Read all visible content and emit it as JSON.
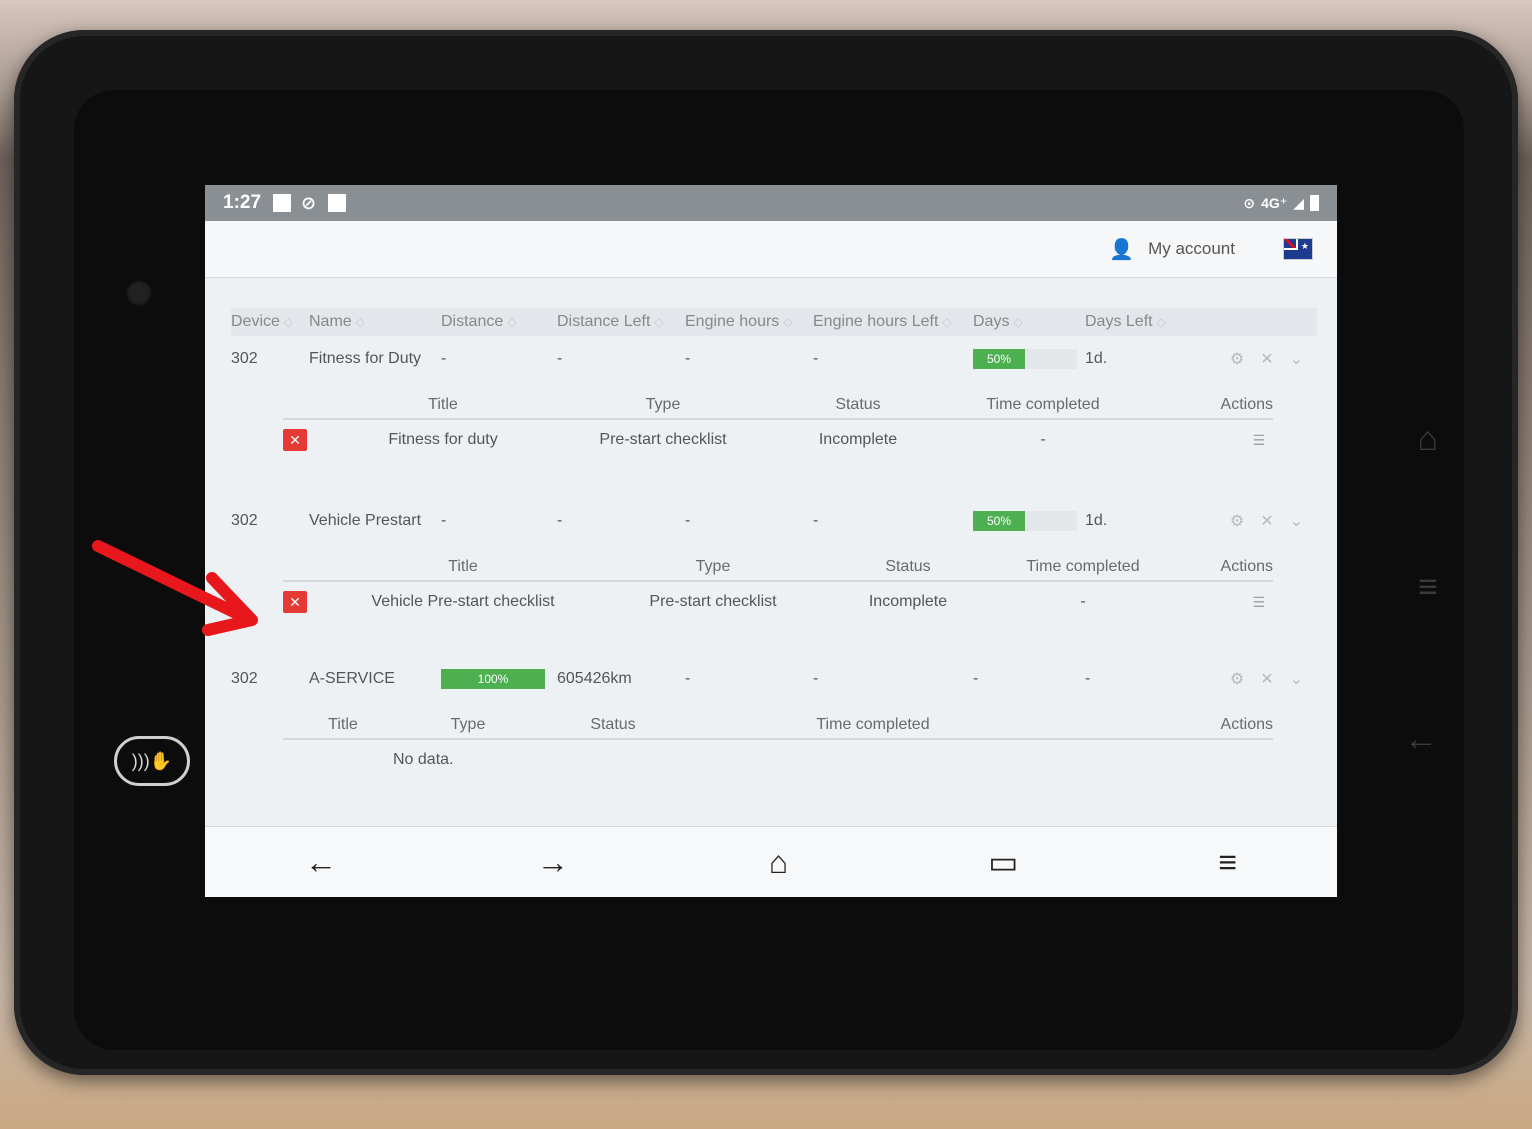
{
  "statusbar": {
    "time": "1:27",
    "network": "4G⁺"
  },
  "topbar": {
    "account_label": "My account"
  },
  "columns": [
    "Device",
    "Name",
    "Distance",
    "Distance Left",
    "Engine hours",
    "Engine hours Left",
    "Days",
    "Days Left"
  ],
  "rows": [
    {
      "device": "302",
      "name": "Fitness for Duty",
      "distance": "-",
      "distance_left": "-",
      "engine_hours": "-",
      "engine_hours_left": "-",
      "days_progress_label": "50%",
      "days_progress": 0.5,
      "days_left": "1d.",
      "sub_headers": [
        "Title",
        "Type",
        "Status",
        "Time completed",
        "Actions"
      ],
      "sub_rows": [
        {
          "title": "Fitness for duty",
          "type": "Pre-start checklist",
          "status": "Incomplete",
          "time_completed": "-"
        }
      ]
    },
    {
      "device": "302",
      "name": "Vehicle Prestart",
      "distance": "-",
      "distance_left": "-",
      "engine_hours": "-",
      "engine_hours_left": "-",
      "days_progress_label": "50%",
      "days_progress": 0.5,
      "days_left": "1d.",
      "sub_headers": [
        "Title",
        "Type",
        "Status",
        "Time completed",
        "Actions"
      ],
      "sub_rows": [
        {
          "title": "Vehicle Pre-start checklist",
          "type": "Pre-start checklist",
          "status": "Incomplete",
          "time_completed": "-"
        }
      ]
    },
    {
      "device": "302",
      "name": "A-SERVICE",
      "distance_progress_label": "100%",
      "distance_progress": 1.0,
      "distance_left": "605426km",
      "engine_hours": "-",
      "engine_hours_left": "-",
      "days": "-",
      "days_left": "-",
      "sub_headers": [
        "Title",
        "Type",
        "Status",
        "Time completed",
        "Actions"
      ],
      "empty_text": "No data."
    }
  ],
  "icons": {
    "account": "user-icon",
    "flag": "australia-flag-icon",
    "row_actions": [
      "gear-icon",
      "close-icon",
      "chevron-down-icon"
    ],
    "delete": "close-icon",
    "details": "list-icon",
    "nav": [
      "back-arrow-icon",
      "forward-arrow-icon",
      "home-icon",
      "tabs-icon",
      "menu-icon"
    ]
  },
  "colors": {
    "progress_fill": "#4cb050",
    "delete_button": "#e53935",
    "annotation_arrow": "#e8171c"
  }
}
